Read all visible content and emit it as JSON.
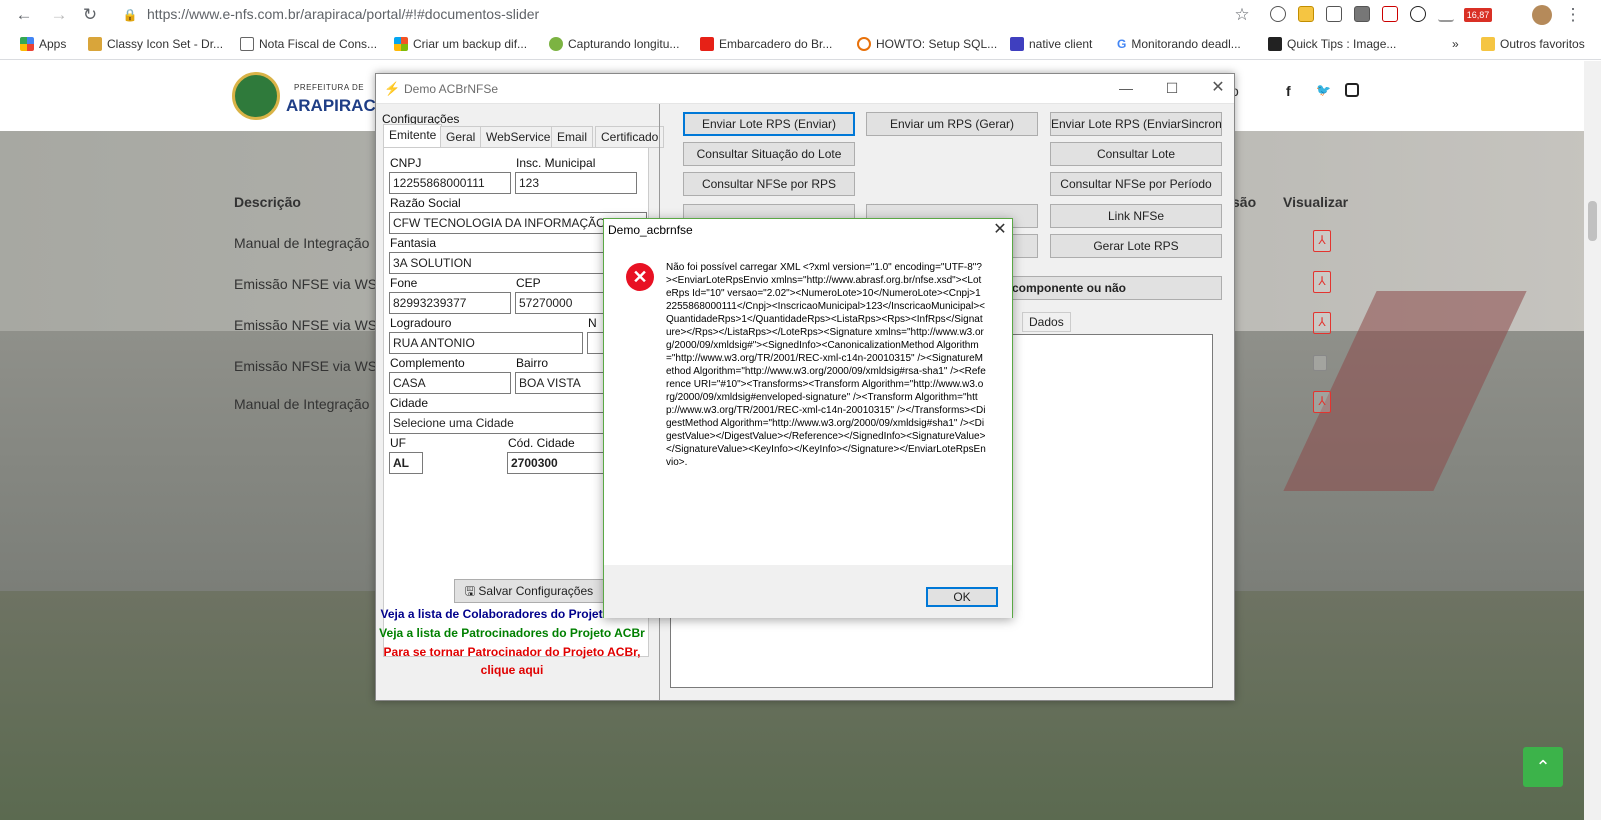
{
  "browser": {
    "url_host": "https://www.e-nfs.com.br",
    "url_path": "/arapiraca/portal/#!#documentos-slider",
    "bookmarks": [
      {
        "label": "Apps"
      },
      {
        "label": "Classy Icon Set - Dr..."
      },
      {
        "label": "Nota Fiscal de Cons..."
      },
      {
        "label": "Criar um backup dif..."
      },
      {
        "label": "Capturando longitu..."
      },
      {
        "label": "Embarcadero do Br..."
      },
      {
        "label": "HOWTO: Setup SQL..."
      },
      {
        "label": "native client"
      },
      {
        "label": "Monitorando deadl..."
      },
      {
        "label": "Quick Tips : Image..."
      }
    ],
    "more": "»",
    "other_favorites": "Outros favoritos",
    "badge": "16,87"
  },
  "site": {
    "pref_small": "PREFEITURA DE",
    "pref_big": "ARAPIRACA",
    "header_fragment": "o",
    "th_desc": "Descrição",
    "th_visualizar": "Visualizar",
    "th_sao": "são",
    "rows": [
      "Manual de Integração",
      "Emissão NFSE via WS",
      "Emissão NFSE via WS",
      "Emissão NFSE via WS",
      "Manual de Integração"
    ]
  },
  "demo": {
    "title": "Demo ACBrNFSe",
    "configuracoes": "Configurações",
    "tabs": [
      "Emitente",
      "Geral",
      "WebService",
      "Email",
      "Certificado"
    ],
    "fields": {
      "cnpj_label": "CNPJ",
      "cnpj": "12255868000111",
      "im_label": "Insc. Municipal",
      "im": "123",
      "razao_label": "Razão Social",
      "razao": "CFW TECNOLOGIA DA INFORMAÇÃO M",
      "fantasia_label": "Fantasia",
      "fantasia": "3A SOLUTION",
      "fone_label": "Fone",
      "fone": "82993239377",
      "cep_label": "CEP",
      "cep": "57270000",
      "logradouro_label": "Logradouro",
      "logradouro": "RUA ANTONIO",
      "numero_label": "N",
      "complemento_label": "Complemento",
      "complemento": "CASA",
      "bairro_label": "Bairro",
      "bairro": "BOA VISTA",
      "cidade_label": "Cidade",
      "cidade": "Selecione uma Cidade",
      "uf_label": "UF",
      "uf": "AL",
      "codcidade_label": "Cód. Cidade",
      "codcidade": "2700300"
    },
    "save_button": "Salvar Configurações",
    "links": [
      {
        "text": "Veja a lista de Colaboradores do Projeto ACBr",
        "color": "#00008b"
      },
      {
        "text": "Veja a lista de Patrocinadores do Projeto ACBr",
        "color": "#008000"
      },
      {
        "text": "Para se tornar Patrocinador do Projeto ACBr,",
        "color": "#e00000"
      },
      {
        "text": "clique aqui",
        "color": "#e00000"
      }
    ],
    "buttons": {
      "enviar_lote": "Enviar Lote RPS (Enviar)",
      "enviar_rps": "Enviar um RPS (Gerar)",
      "enviar_sincrono": "Enviar Lote RPS (EnviarSincrono)",
      "consultar_situacao": "Consultar Situação do Lote",
      "consultar_lote": "Consultar Lote",
      "consultar_nfse_rps": "Consultar NFSe por RPS",
      "consultar_nfse_periodo": "Consultar NFSe por Período",
      "link_nfse": "Link NFSe",
      "gerar_lote": "Gerar Lote RPS",
      "componente": "componente ou não"
    },
    "right_tab": "Dados"
  },
  "dialog": {
    "title": "Demo_acbrnfse",
    "message": "Não foi possível carregar XML\n<?xml version=\"1.0\" encoding=\"UTF-8\"?><EnviarLoteRpsEnvio xmlns=\"http://www.abrasf.org.br/nfse.xsd\"><LoteRps Id=\"10\" versao=\"2.02\"><NumeroLote>10</NumeroLote><Cnpj>12255868000111</Cnpj><InscricaoMunicipal>123</InscricaoMunicipal><QuantidadeRps>1</QuantidadeRps><ListaRps><Rps><InfRps</Signature></Rps></ListaRps></LoteRps><Signature xmlns=\"http://www.w3.org/2000/09/xmldsig#\"><SignedInfo><CanonicalizationMethod Algorithm=\"http://www.w3.org/TR/2001/REC-xml-c14n-20010315\" /><SignatureMethod Algorithm=\"http://www.w3.org/2000/09/xmldsig#rsa-sha1\" /><Reference URI=\"#10\"><Transforms><Transform Algorithm=\"http://www.w3.org/2000/09/xmldsig#enveloped-signature\" /><Transform Algorithm=\"http://www.w3.org/TR/2001/REC-xml-c14n-20010315\" /></Transforms><DigestMethod Algorithm=\"http://www.w3.org/2000/09/xmldsig#sha1\" /><DigestValue></DigestValue></Reference></SignedInfo><SignatureValue></SignatureValue><KeyInfo></KeyInfo></Signature></EnviarLoteRpsEnvio>.",
    "ok": "OK"
  }
}
